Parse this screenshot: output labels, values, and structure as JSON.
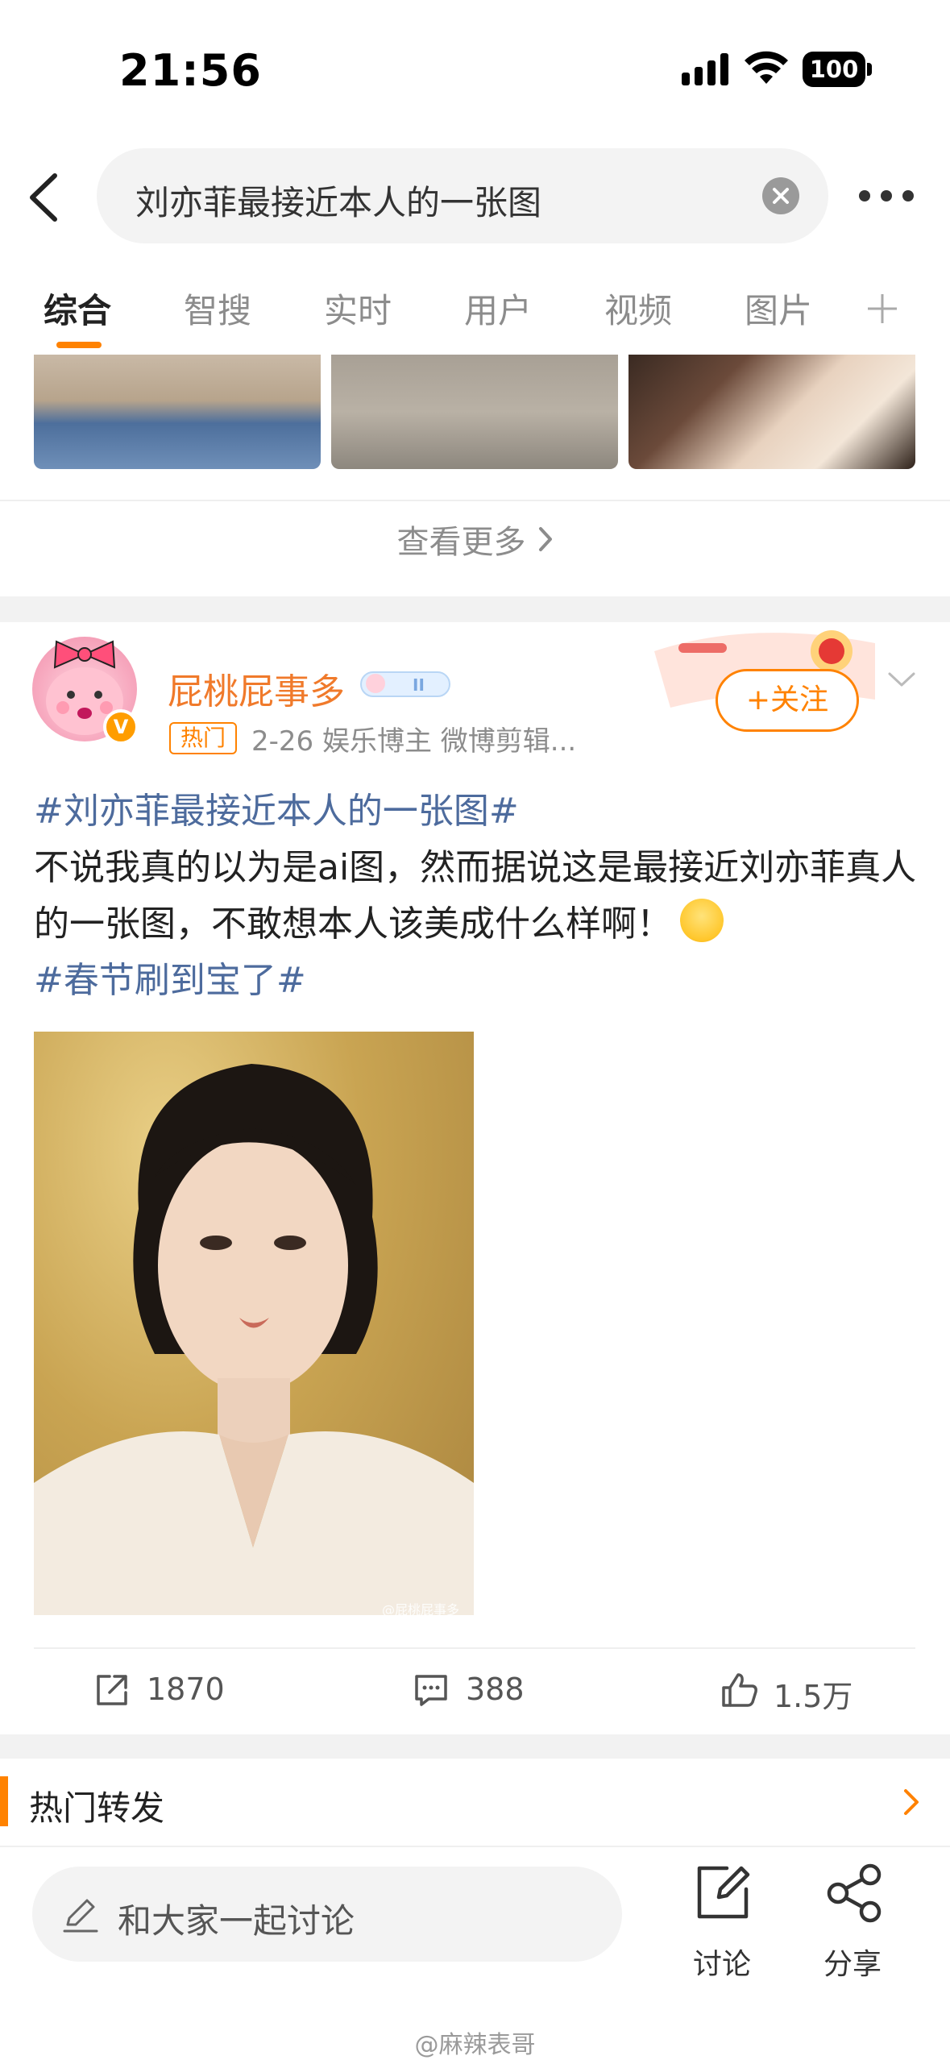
{
  "status_bar": {
    "time": "21:56",
    "battery": "100"
  },
  "search": {
    "query": "刘亦菲最接近本人的一张图"
  },
  "tabs": [
    {
      "label": "综合",
      "active": true
    },
    {
      "label": "智搜"
    },
    {
      "label": "实时"
    },
    {
      "label": "用户"
    },
    {
      "label": "视频"
    },
    {
      "label": "图片"
    }
  ],
  "see_more": "查看更多",
  "post": {
    "username": "屁桃屁事多",
    "hot_tag": "热门",
    "meta": "2-26  娱乐博主 微博剪辑...",
    "follow_label": "+关注",
    "hashtag_top": "#刘亦菲最接近本人的一张图#",
    "body": "不说我真的以为是ai图，然而据说这是最接近刘亦菲真人的一张图，不敢想本人该美成什么样啊！",
    "hashtag_bottom": "#春节刷到宝了#",
    "image_watermark": "@屁桃屁事多",
    "reposts": "1870",
    "comments": "388",
    "likes": "1.5万"
  },
  "hot_repost": {
    "label": "热门转发"
  },
  "bottom_bar": {
    "comment_placeholder": "和大家一起讨论",
    "discuss_label": "讨论",
    "share_label": "分享"
  },
  "footer_watermark": "@麻辣表哥",
  "colors": {
    "accent": "#ff8200",
    "hashtag": "#4d6b9d",
    "username": "#f07a2b"
  }
}
